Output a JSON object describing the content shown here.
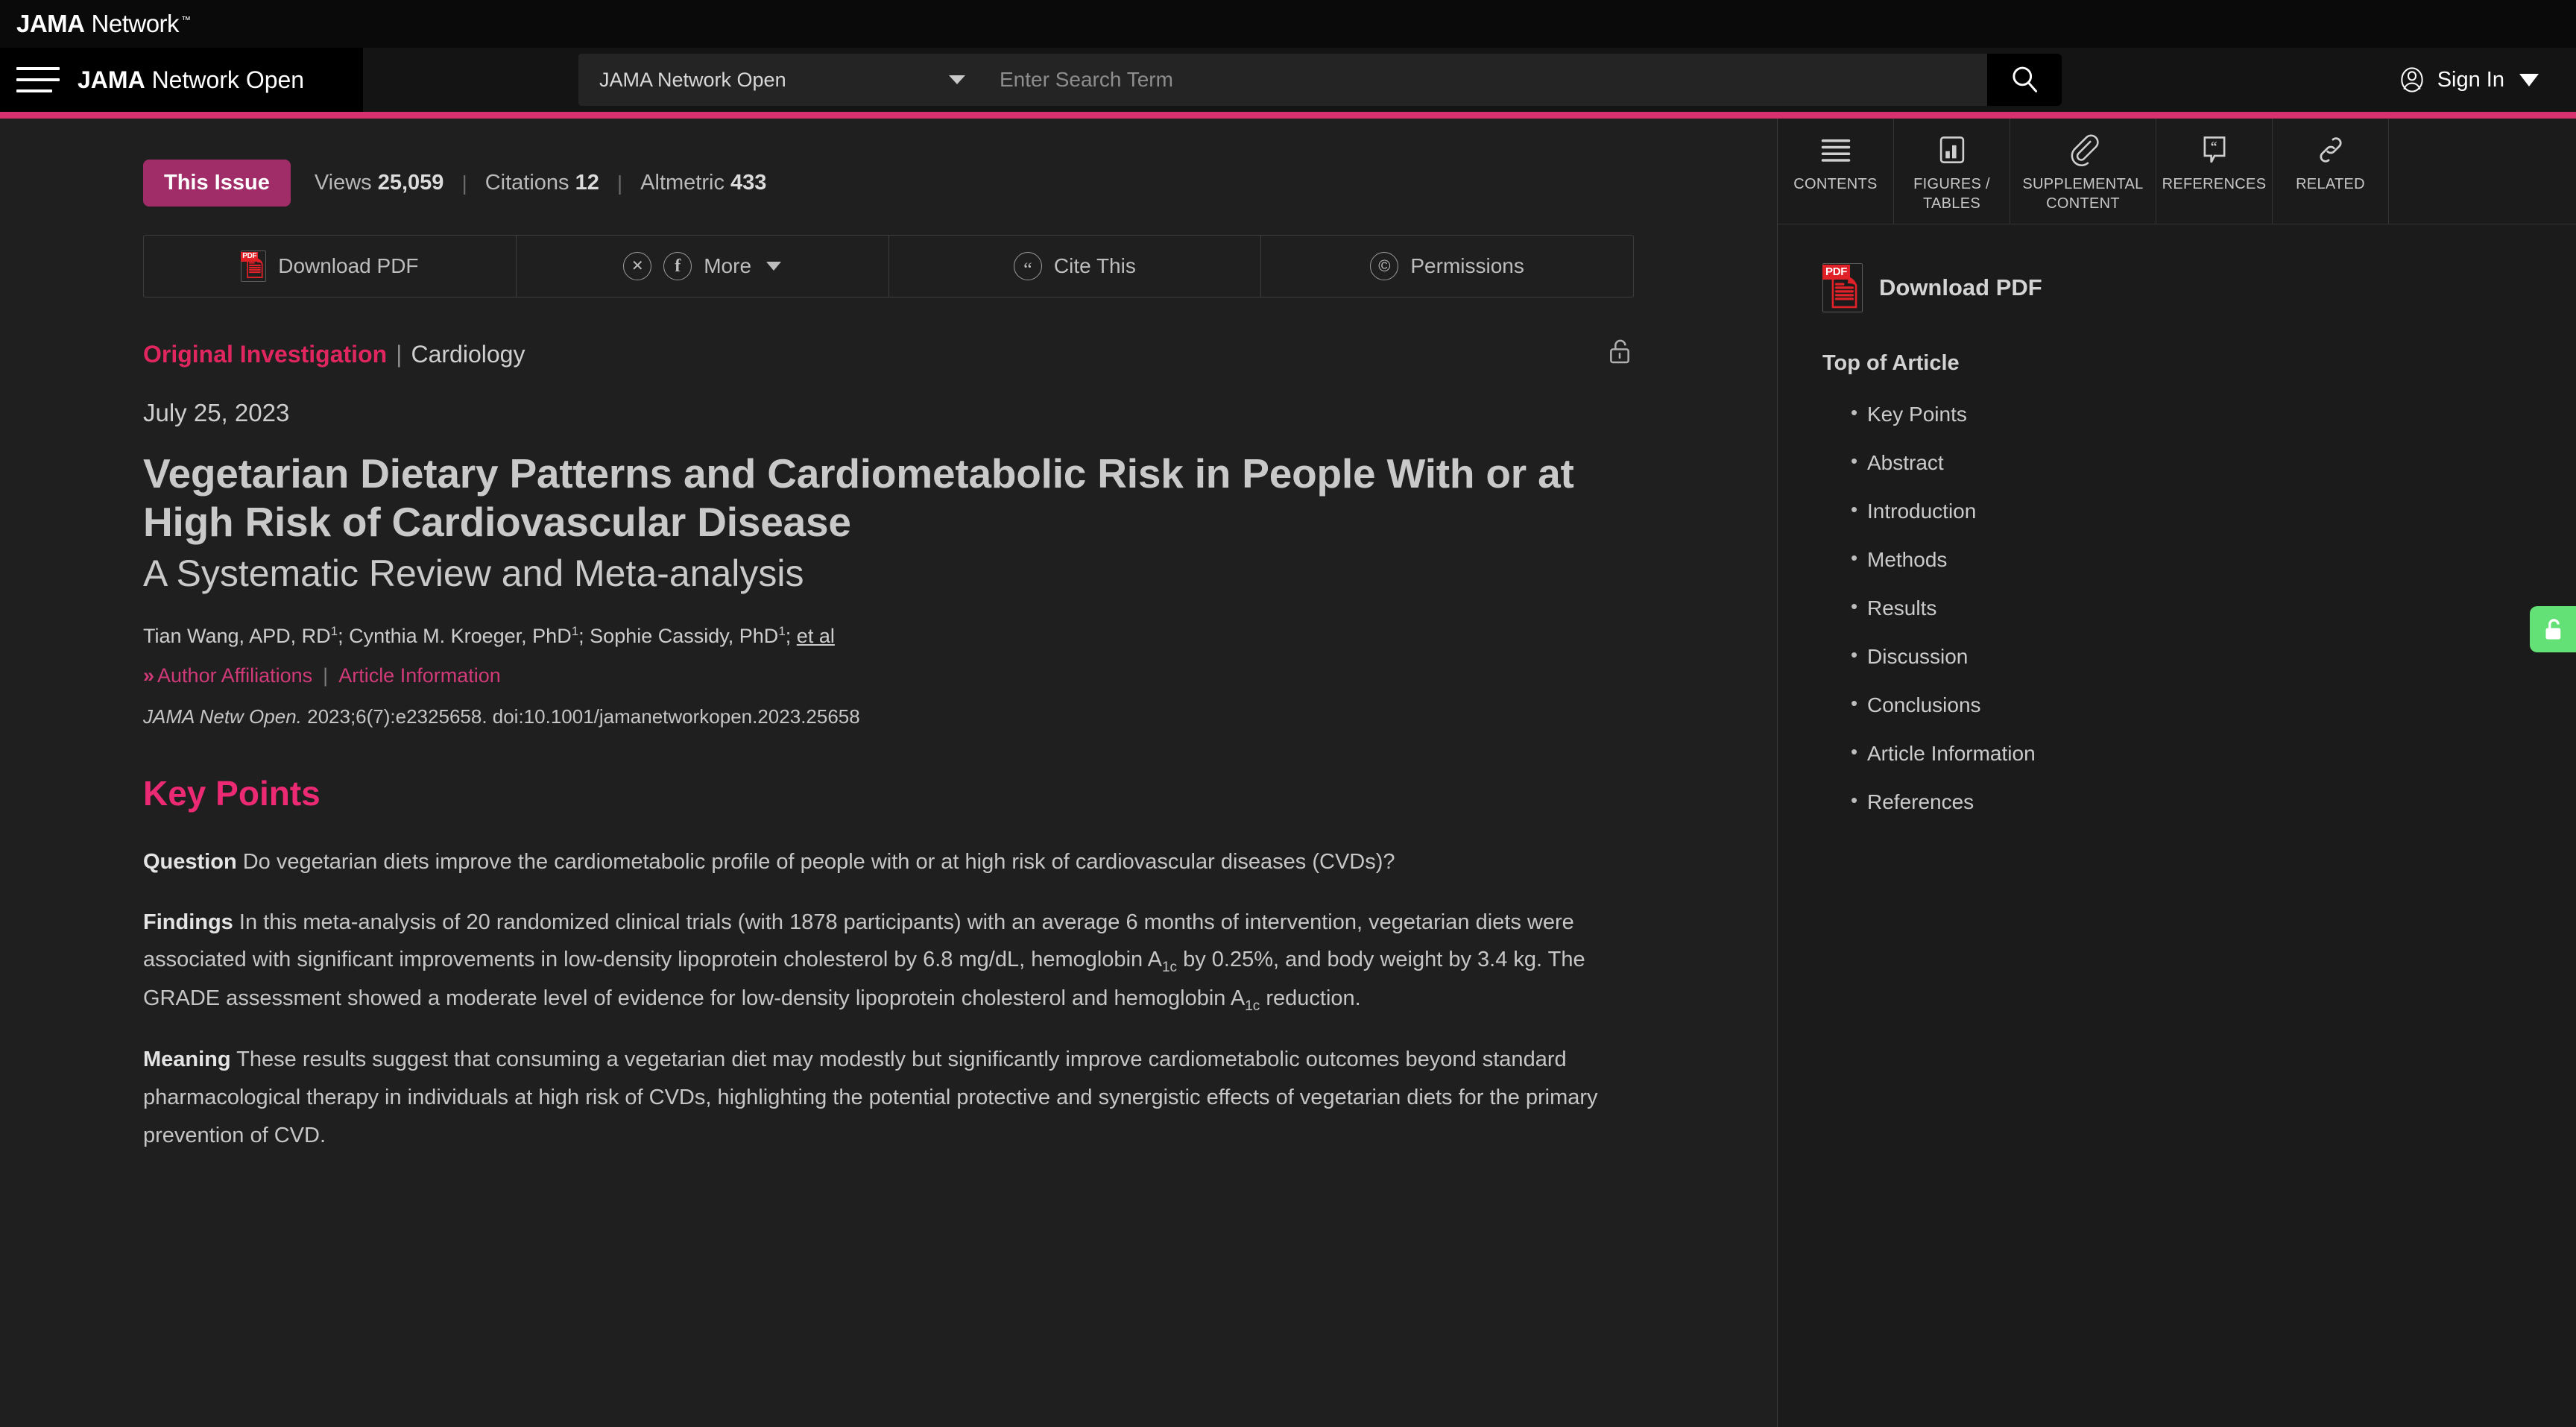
{
  "brand": {
    "logo_jama": "JAMA",
    "logo_network": "Network",
    "logo_tm": "™"
  },
  "nav": {
    "journal_bold": "JAMA",
    "journal_light": " Network Open",
    "menu_icon": "hamburger-icon",
    "signin_label": "Sign In"
  },
  "search": {
    "scope_value": "JAMA Network Open",
    "placeholder": "Enter Search Term",
    "value": "",
    "button_icon": "search-icon"
  },
  "metrics": {
    "this_issue": "This Issue",
    "items": [
      {
        "label": "Views",
        "value": "25,059"
      },
      {
        "label": "Citations",
        "value": "12"
      },
      {
        "label": "Altmetric",
        "value": "433"
      }
    ]
  },
  "actions": [
    {
      "label": "Download PDF",
      "icon": "pdf-icon"
    },
    {
      "label": "More",
      "icon": "share-icons"
    },
    {
      "label": "Cite This",
      "icon": "quote-icon"
    },
    {
      "label": "Permissions",
      "icon": "copyright-icon"
    }
  ],
  "article": {
    "type": "Original Investigation",
    "separator": "|",
    "category": "Cardiology",
    "access_icon": "open-lock-icon",
    "date": "July 25, 2023",
    "title": "Vegetarian Dietary Patterns and Cardiometabolic Risk in People With or at High Risk of Cardiovascular Disease",
    "subtitle": "A Systematic Review and Meta-analysis",
    "authors_html": "Tian Wang, APD, RD<sup>1</sup>; Cynthia M. Kroeger, PhD<sup>1</sup>; Sophie Cassidy, PhD<sup>1</sup>; <u>et al</u>",
    "author_affiliations": "Author Affiliations",
    "article_information": "Article Information",
    "citation_journal": "JAMA Netw Open.",
    "citation_rest": " 2023;6(7):e2325658. doi:10.1001/jamanetworkopen.2023.25658"
  },
  "keypoints": {
    "heading": "Key Points",
    "question_label": "Question",
    "question_text": "Do vegetarian diets improve the cardiometabolic profile of people with or at high risk of cardiovascular diseases (CVDs)?",
    "findings_label": "Findings",
    "findings_html": "In this meta-analysis of 20 randomized clinical trials (with 1878 participants) with an average 6 months of intervention, vegetarian diets were associated with significant improvements in low-density lipoprotein cholesterol by 6.8 mg/dL, hemoglobin A<sub>1c</sub> by 0.25%, and body weight by 3.4 kg. The GRADE assessment showed a moderate level of evidence for low-density lipoprotein cholesterol and hemoglobin A<sub>1c</sub> reduction.",
    "meaning_label": "Meaning",
    "meaning_text": "These results suggest that consuming a vegetarian diet may modestly but significantly improve cardiometabolic outcomes beyond standard pharmacological therapy in individuals at high risk of CVDs, highlighting the potential protective and synergistic effects of vegetarian diets for the primary prevention of CVD."
  },
  "sidebar": {
    "tabs": [
      {
        "label": "CONTENTS",
        "icon": "list-lines-icon",
        "active": true
      },
      {
        "label": "FIGURES / TABLES",
        "icon": "bar-chart-icon",
        "active": false
      },
      {
        "label": "SUPPLEMENTAL CONTENT",
        "icon": "paperclip-icon",
        "active": false
      },
      {
        "label": "REFERENCES",
        "icon": "quote-bubble-icon",
        "active": false
      },
      {
        "label": "RELATED",
        "icon": "link-chain-icon",
        "active": false
      }
    ],
    "download_pdf": "Download PDF",
    "toc_top": "Top of Article",
    "toc_items": [
      "Key Points",
      "Abstract",
      "Introduction",
      "Methods",
      "Results",
      "Discussion",
      "Conclusions",
      "Article Information",
      "References"
    ]
  },
  "access_tab": {
    "icon": "open-lock-icon"
  },
  "colors": {
    "brand_pink": "#d7316f",
    "accent_pink": "#ec2a74",
    "badge_magenta": "#a12d68",
    "link_pink": "#d03a79",
    "open_access_green": "#63e177",
    "pdf_red": "#e02127",
    "page_bg": "#1f1f1f",
    "sidebar_bg": "#1b1b1b",
    "navbar_bg": "#141414",
    "brandbar_bg": "#0a0a0a"
  }
}
